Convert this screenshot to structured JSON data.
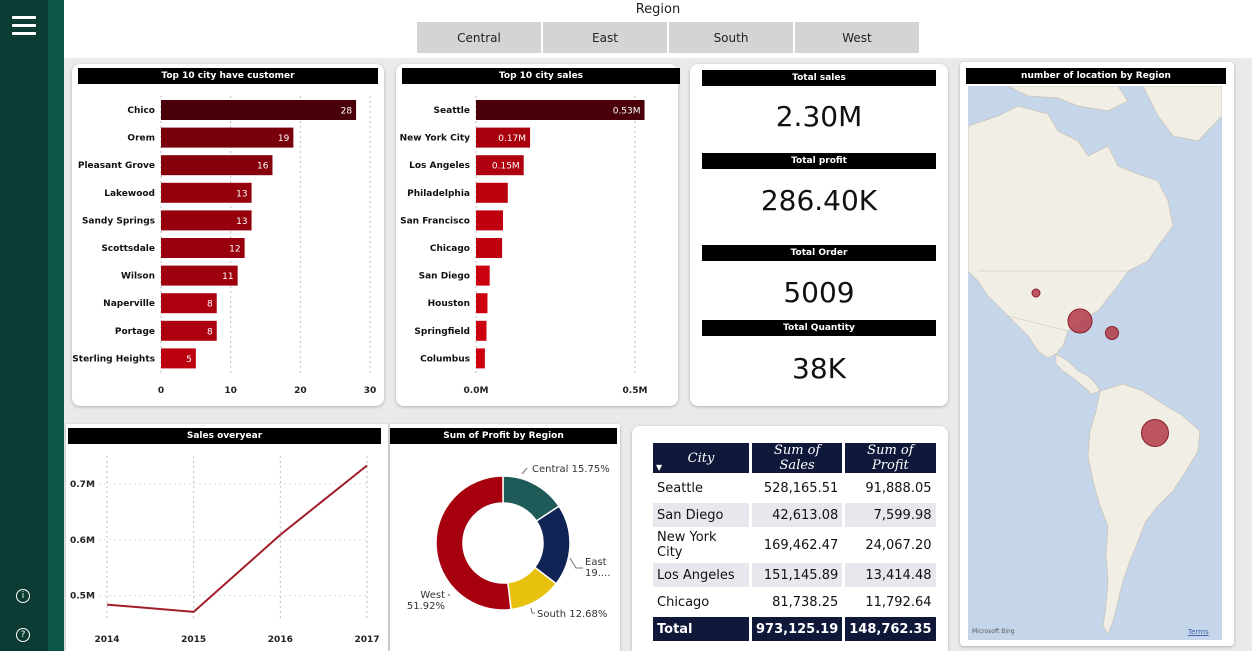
{
  "nav": {
    "info_icon": "info-icon",
    "help_icon": "help-icon"
  },
  "slicer": {
    "title": "Region",
    "options": [
      "Central",
      "East",
      "South",
      "West"
    ]
  },
  "customers_chart": {
    "title": "Top 10 city have customer",
    "chart_data": {
      "type": "bar",
      "categories": [
        "Chico",
        "Orem",
        "Pleasant Grove",
        "Lakewood",
        "Sandy Springs",
        "Scottsdale",
        "Wilson",
        "Naperville",
        "Portage",
        "Sterling Heights"
      ],
      "values": [
        28,
        19,
        16,
        13,
        13,
        12,
        11,
        8,
        8,
        5
      ],
      "data_labels": [
        "28",
        "19",
        "16",
        "13",
        "13",
        "12",
        "11",
        "8",
        "8",
        "5"
      ],
      "xlim": [
        0,
        30
      ],
      "xticks": [
        "0",
        "10",
        "20",
        "30"
      ]
    }
  },
  "sales_chart": {
    "title": "Top 10 city  sales",
    "chart_data": {
      "type": "bar",
      "categories": [
        "Seattle",
        "New York City",
        "Los Angeles",
        "Philadelphia",
        "San Francisco",
        "Chicago",
        "San Diego",
        "Houston",
        "Springfield",
        "Columbus"
      ],
      "values": [
        0.53,
        0.17,
        0.15,
        0.1,
        0.085,
        0.082,
        0.043,
        0.036,
        0.033,
        0.028
      ],
      "data_labels": [
        "0.53M",
        "0.17M",
        "0.15M",
        "",
        "",
        "",
        "",
        "",
        "",
        ""
      ],
      "xlim": [
        0,
        0.5
      ],
      "xticks": [
        "0.0M",
        "0.5M"
      ]
    }
  },
  "kpis": {
    "total_sales": {
      "label": "Total sales",
      "value": "2.30M"
    },
    "total_profit": {
      "label": "Total profit",
      "value": "286.40K"
    },
    "total_order": {
      "label": "Total Order",
      "value": "5009"
    },
    "total_quantity": {
      "label": "Total Quantity",
      "value": "38K"
    }
  },
  "map": {
    "title": "number of location by Region",
    "attribution": "Microsoft Bing",
    "terms": "Terms",
    "bubbles": [
      {
        "label": "West-US",
        "size": 1
      },
      {
        "label": "Central-US",
        "size": 3
      },
      {
        "label": "Caribbean",
        "size": 2
      },
      {
        "label": "South America",
        "size": 4
      }
    ]
  },
  "line_chart": {
    "title": "Sales overyear",
    "chart_data": {
      "type": "line",
      "x": [
        "2014",
        "2015",
        "2016",
        "2017"
      ],
      "values": [
        0.484,
        0.471,
        0.609,
        0.733
      ],
      "ylim": [
        0.46,
        0.75
      ],
      "yticks": [
        "0.5M",
        "0.6M",
        "0.7M"
      ],
      "color": "#a01c28"
    }
  },
  "donut_chart": {
    "title": "Sum of Profit by Region",
    "chart_data": {
      "type": "pie",
      "slices": [
        {
          "name": "Central",
          "pct": 15.75,
          "label": "Central 15.75%",
          "color": "#1d5a58"
        },
        {
          "name": "East",
          "pct": 19.65,
          "label": "East",
          "label2": "19....",
          "color": "#0f2355"
        },
        {
          "name": "South",
          "pct": 12.68,
          "label": "South 12.68%",
          "color": "#e8c00e"
        },
        {
          "name": "West",
          "pct": 51.92,
          "label": "West",
          "label2": "51.92%",
          "color": "#a6000e"
        }
      ]
    }
  },
  "table": {
    "headers": [
      "City",
      "Sum of Sales",
      "Sum of Profit"
    ],
    "rows": [
      [
        "Seattle",
        "528,165.51",
        "91,888.05"
      ],
      [
        "San Diego",
        "42,613.08",
        "7,599.98"
      ],
      [
        "New York City",
        "169,462.47",
        "24,067.20"
      ],
      [
        "Los Angeles",
        "151,145.89",
        "13,414.48"
      ],
      [
        "Chicago",
        "81,738.25",
        "11,792.64"
      ]
    ],
    "total": [
      "Total",
      "973,125.19",
      "148,762.35"
    ]
  }
}
